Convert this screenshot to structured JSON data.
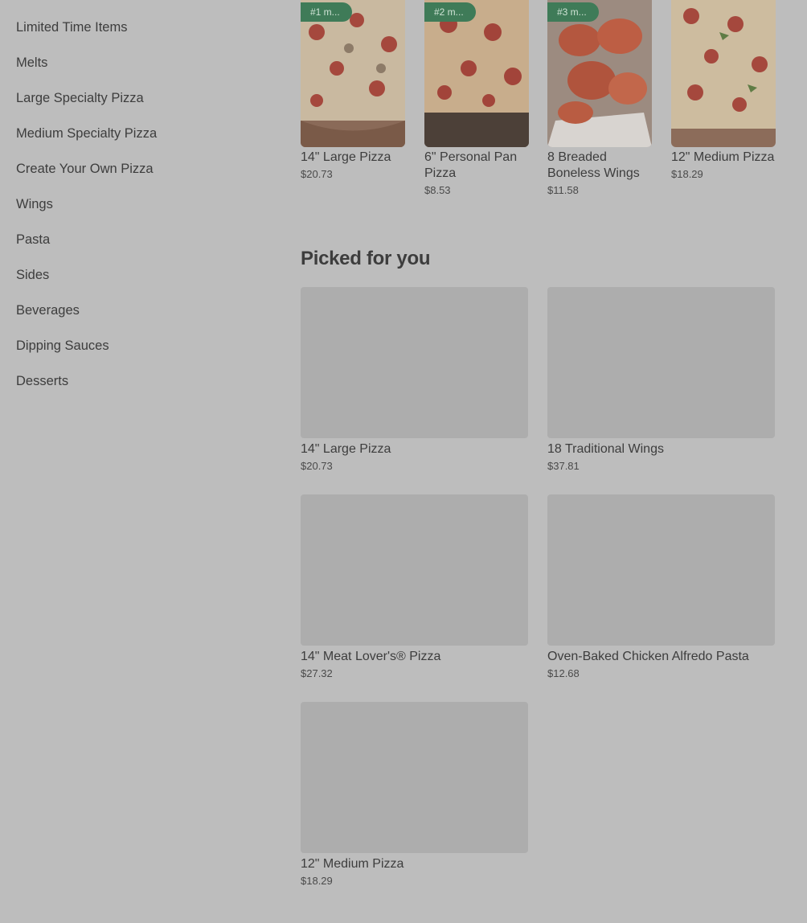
{
  "sidebar": {
    "items": [
      {
        "label": "Limited Time Items"
      },
      {
        "label": "Melts"
      },
      {
        "label": "Large Specialty Pizza"
      },
      {
        "label": "Medium Specialty Pizza"
      },
      {
        "label": "Create Your Own Pizza"
      },
      {
        "label": "Wings"
      },
      {
        "label": "Pasta"
      },
      {
        "label": "Sides"
      },
      {
        "label": "Beverages"
      },
      {
        "label": "Dipping Sauces"
      },
      {
        "label": "Desserts"
      }
    ]
  },
  "popular": {
    "items": [
      {
        "badge": "#1 m...",
        "name": "14\" Large Pizza",
        "price": "$20.73"
      },
      {
        "badge": "#2 m...",
        "name": "6\" Personal Pan Pizza",
        "price": "$8.53"
      },
      {
        "badge": "#3 m...",
        "name": "8 Breaded Boneless Wings",
        "price": "$11.58"
      },
      {
        "badge": "",
        "name": "12\" Medium Pizza",
        "price": "$18.29"
      }
    ]
  },
  "picked": {
    "title": "Picked for you",
    "items": [
      {
        "name": "14\" Large Pizza",
        "price": "$20.73"
      },
      {
        "name": "18 Traditional Wings",
        "price": "$37.81"
      },
      {
        "name": "14\" Meat Lover's® Pizza",
        "price": "$27.32"
      },
      {
        "name": "Oven-Baked Chicken Alfredo Pasta",
        "price": "$12.68"
      },
      {
        "name": "12\" Medium Pizza",
        "price": "$18.29"
      }
    ]
  }
}
